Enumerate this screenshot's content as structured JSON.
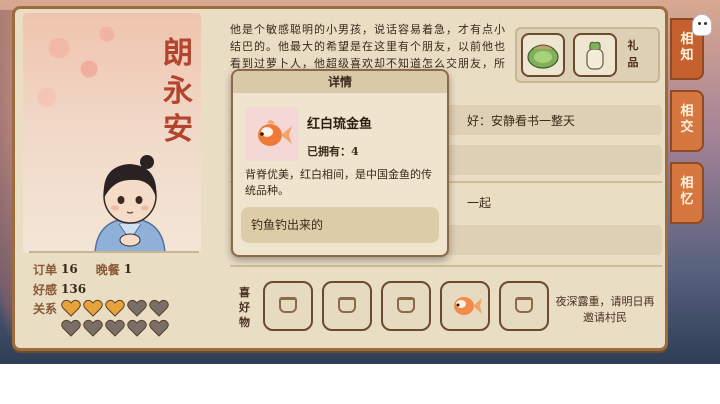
{
  "character": {
    "name_chars": [
      "朗",
      "永",
      "安"
    ],
    "description": "他是个敏感聪明的小男孩，说话容易着急，才有点小结巴的。他最大的希望是在这里有个朋友，以前他也看到过萝卜人，他超级喜欢却不知道怎么交朋友，所以他常常会约到萝萝山上"
  },
  "stats": {
    "orders_label": "订单",
    "orders_value": "16",
    "dinner_label": "晚餐",
    "dinner_value": "1",
    "favor_label": "好感",
    "favor_value": "136",
    "relation_label": "关系",
    "hearts_filled": 3,
    "hearts_total": 10,
    "heart_filled_color": "#e8a43a",
    "heart_empty_color": "#7a6f68"
  },
  "gifts": {
    "label": "礼品"
  },
  "info_rows": {
    "hobby_visible": "好：安静看书一整天",
    "together_visible": "一起"
  },
  "preferences": {
    "label": "喜好物",
    "note": "夜深露重，请明日再邀请村民"
  },
  "tabs": {
    "know": "相知",
    "meet": "相交",
    "memory": "相忆"
  },
  "popup": {
    "header": "详情",
    "item_name": "红白琉金鱼",
    "owned_label": "已拥有：",
    "owned_count": "4",
    "description": "背脊优美，红白相间，是中国金鱼的传统品种。",
    "source": "钓鱼钓出来的"
  }
}
